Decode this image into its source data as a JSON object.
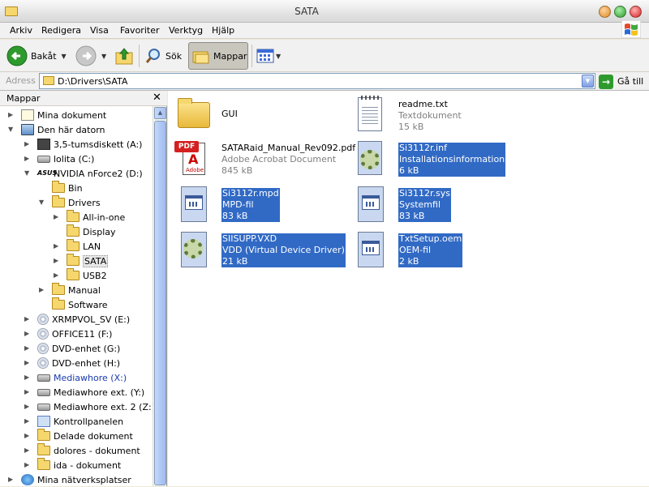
{
  "window": {
    "title": "SATA"
  },
  "menu": [
    "Arkiv",
    "Redigera",
    "Visa",
    "Favoriter",
    "Verktyg",
    "Hjälp"
  ],
  "toolbar": {
    "back": "Bakåt",
    "search": "Sök",
    "folders": "Mappar"
  },
  "address": {
    "label": "Adress",
    "value": "D:\\Drivers\\SATA",
    "go": "Gå till"
  },
  "folder_pane": {
    "title": "Mappar",
    "items": [
      {
        "label": "Mina dokument",
        "icon": "my-documents-icon"
      },
      {
        "label": "Den här datorn",
        "icon": "my-computer-icon"
      },
      {
        "label": "3,5-tumsdiskett (A:)",
        "icon": "floppy-icon"
      },
      {
        "label": "lolita (C:)",
        "icon": "hard-drive-icon"
      },
      {
        "label": "NVIDIA nForce2 (D:)",
        "icon": "asus-drive-icon"
      },
      {
        "label": "Bin",
        "icon": "folder-icon"
      },
      {
        "label": "Drivers",
        "icon": "folder-icon"
      },
      {
        "label": "All-in-one",
        "icon": "folder-icon"
      },
      {
        "label": "Display",
        "icon": "folder-icon"
      },
      {
        "label": "LAN",
        "icon": "folder-icon"
      },
      {
        "label": "SATA",
        "icon": "folder-icon"
      },
      {
        "label": "USB2",
        "icon": "folder-icon"
      },
      {
        "label": "Manual",
        "icon": "folder-icon"
      },
      {
        "label": "Software",
        "icon": "folder-icon"
      },
      {
        "label": "XRMPVOL_SV (E:)",
        "icon": "cd-drive-icon"
      },
      {
        "label": "OFFICE11 (F:)",
        "icon": "cd-drive-icon"
      },
      {
        "label": "DVD-enhet (G:)",
        "icon": "dvd-drive-icon"
      },
      {
        "label": "DVD-enhet (H:)",
        "icon": "dvd-drive-icon"
      },
      {
        "label": "Mediawhore (X:)",
        "icon": "network-drive-icon"
      },
      {
        "label": "Mediawhore ext. (Y:)",
        "icon": "network-drive-icon"
      },
      {
        "label": "Mediawhore ext. 2 (Z:)",
        "icon": "network-drive-icon"
      },
      {
        "label": "Kontrollpanelen",
        "icon": "control-panel-icon"
      },
      {
        "label": "Delade dokument",
        "icon": "folder-icon"
      },
      {
        "label": "dolores - dokument",
        "icon": "folder-icon"
      },
      {
        "label": "ida - dokument",
        "icon": "folder-icon"
      },
      {
        "label": "Mina nätverksplatser",
        "icon": "network-places-icon"
      }
    ]
  },
  "files": [
    {
      "name": "GUI",
      "type": "",
      "size": "",
      "icon": "folder-icon",
      "selected": false
    },
    {
      "name": "readme.txt",
      "type": "Textdokument",
      "size": "15 kB",
      "icon": "text-file-icon",
      "selected": false
    },
    {
      "name": "SATARaid_Manual_Rev092.pdf",
      "type": "Adobe Acrobat Document",
      "size": "845 kB",
      "icon": "pdf-file-icon",
      "selected": false
    },
    {
      "name": "Si3112r.inf",
      "type": "Installationsinformation",
      "size": "6 kB",
      "icon": "inf-file-icon",
      "selected": true
    },
    {
      "name": "Si3112r.mpd",
      "type": "MPD-fil",
      "size": "83 kB",
      "icon": "generic-file-icon",
      "selected": true
    },
    {
      "name": "Si3112r.sys",
      "type": "Systemfil",
      "size": "83 kB",
      "icon": "system-file-icon",
      "selected": true
    },
    {
      "name": "SIISUPP.VXD",
      "type": "VDD (Virtual Device Driver)",
      "size": "21 kB",
      "icon": "driver-file-icon",
      "selected": true
    },
    {
      "name": "TxtSetup.oem",
      "type": "OEM-fil",
      "size": "2 kB",
      "icon": "generic-file-icon",
      "selected": true
    }
  ],
  "colors": {
    "selection": "#316ac5",
    "link": "#1a3aad"
  }
}
